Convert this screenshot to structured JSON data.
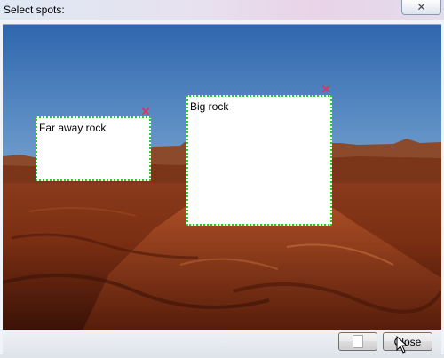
{
  "window": {
    "title": "Select spots:",
    "close_glyph": "✕"
  },
  "spots": [
    {
      "label": "Far away rock",
      "remove_glyph": "✕"
    },
    {
      "label": "Big rock",
      "remove_glyph": "✕"
    }
  ],
  "footer": {
    "close_label": "Close"
  },
  "colors": {
    "spot_border": "#1fd11f",
    "remove_icon": "#e0345a"
  }
}
